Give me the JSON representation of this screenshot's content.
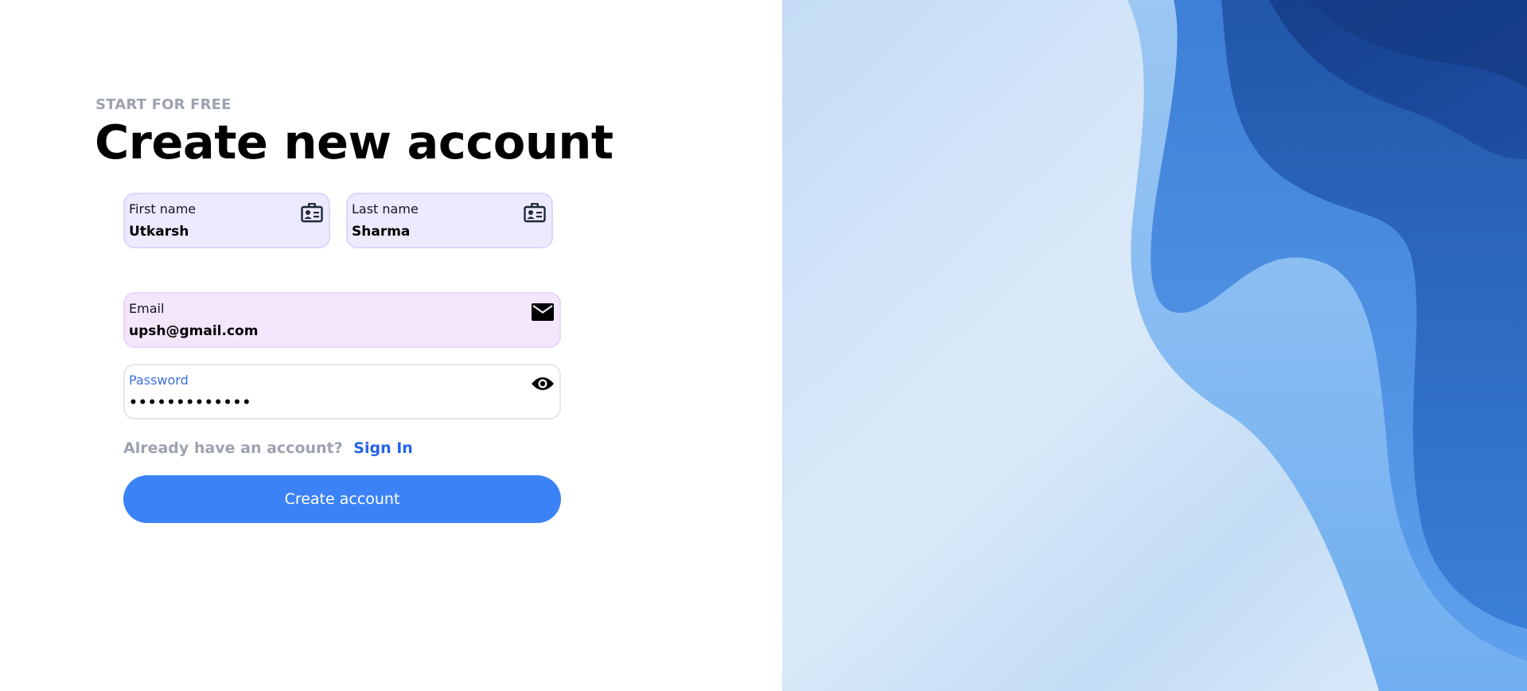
{
  "eyebrow": "START FOR FREE",
  "title": "Create new account",
  "form": {
    "first_name": {
      "label": "First name",
      "value": "Utkarsh",
      "icon": "contact-card-icon"
    },
    "last_name": {
      "label": "Last name",
      "value": "Sharma",
      "icon": "contact-card-icon"
    },
    "email": {
      "label": "Email",
      "value": "upsh@gmail.com",
      "icon": "envelope-icon"
    },
    "password": {
      "label": "Password",
      "value": "•••••••••••••",
      "icon": "eye-icon"
    }
  },
  "signin": {
    "prompt": "Already have an account?",
    "link": "Sign In"
  },
  "submit_label": "Create account",
  "colors": {
    "accent": "#3b82f6",
    "link": "#2563eb",
    "muted": "#9ca3af",
    "field_bg": "#ede9fe"
  }
}
